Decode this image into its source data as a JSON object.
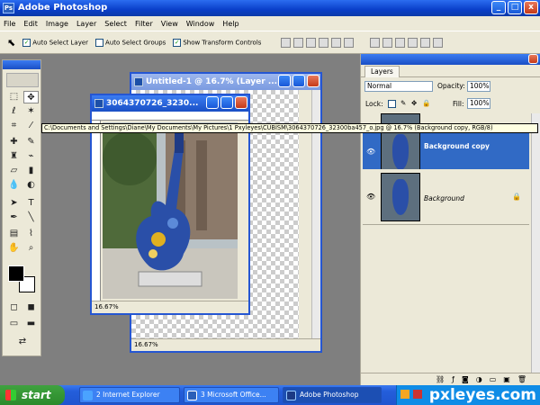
{
  "app": {
    "title": "Adobe Photoshop",
    "icon_text": "Ps"
  },
  "window_controls": {
    "minimize": "_",
    "maximize": "□",
    "close": "x"
  },
  "menu": [
    "File",
    "Edit",
    "Image",
    "Layer",
    "Select",
    "Filter",
    "View",
    "Window",
    "Help"
  ],
  "options": {
    "tool_glyph": "⬉",
    "auto_select_layer": "Auto Select Layer",
    "auto_select_groups": "Auto Select Groups",
    "show_transform_controls": "Show Transform Controls"
  },
  "documents": {
    "untitled": {
      "title": "Untitled-1 @ 16.7% (Layer ...",
      "zoom": "16.67%"
    },
    "photo": {
      "title": "3064370726_3230...",
      "zoom": "16.67%"
    }
  },
  "tooltip": "C:\\Documents and Settings\\Diane\\My Documents\\My Pictures\\1 Pxyleyes\\CUBISM\\3064370726_32300ba457_o.jpg @ 16.7% (Background copy, RGB/8)",
  "layers_panel": {
    "tab": "Layers",
    "blend_mode": "Normal",
    "opacity_label": "Opacity:",
    "opacity_value": "100%",
    "lock_label": "Lock:",
    "fill_label": "Fill:",
    "fill_value": "100%",
    "layers": [
      {
        "name": "Background copy",
        "active": true
      },
      {
        "name": "Background",
        "active": false
      }
    ]
  },
  "taskbar": {
    "start": "start",
    "tasks": [
      "2 Internet Explorer",
      "3 Microsoft Office...",
      "Adobe Photoshop"
    ],
    "brand": "pxleyes.com"
  },
  "colors": {
    "xp_blue": "#245edb",
    "selection": "#316ac5",
    "start_green": "#3fa23f"
  }
}
